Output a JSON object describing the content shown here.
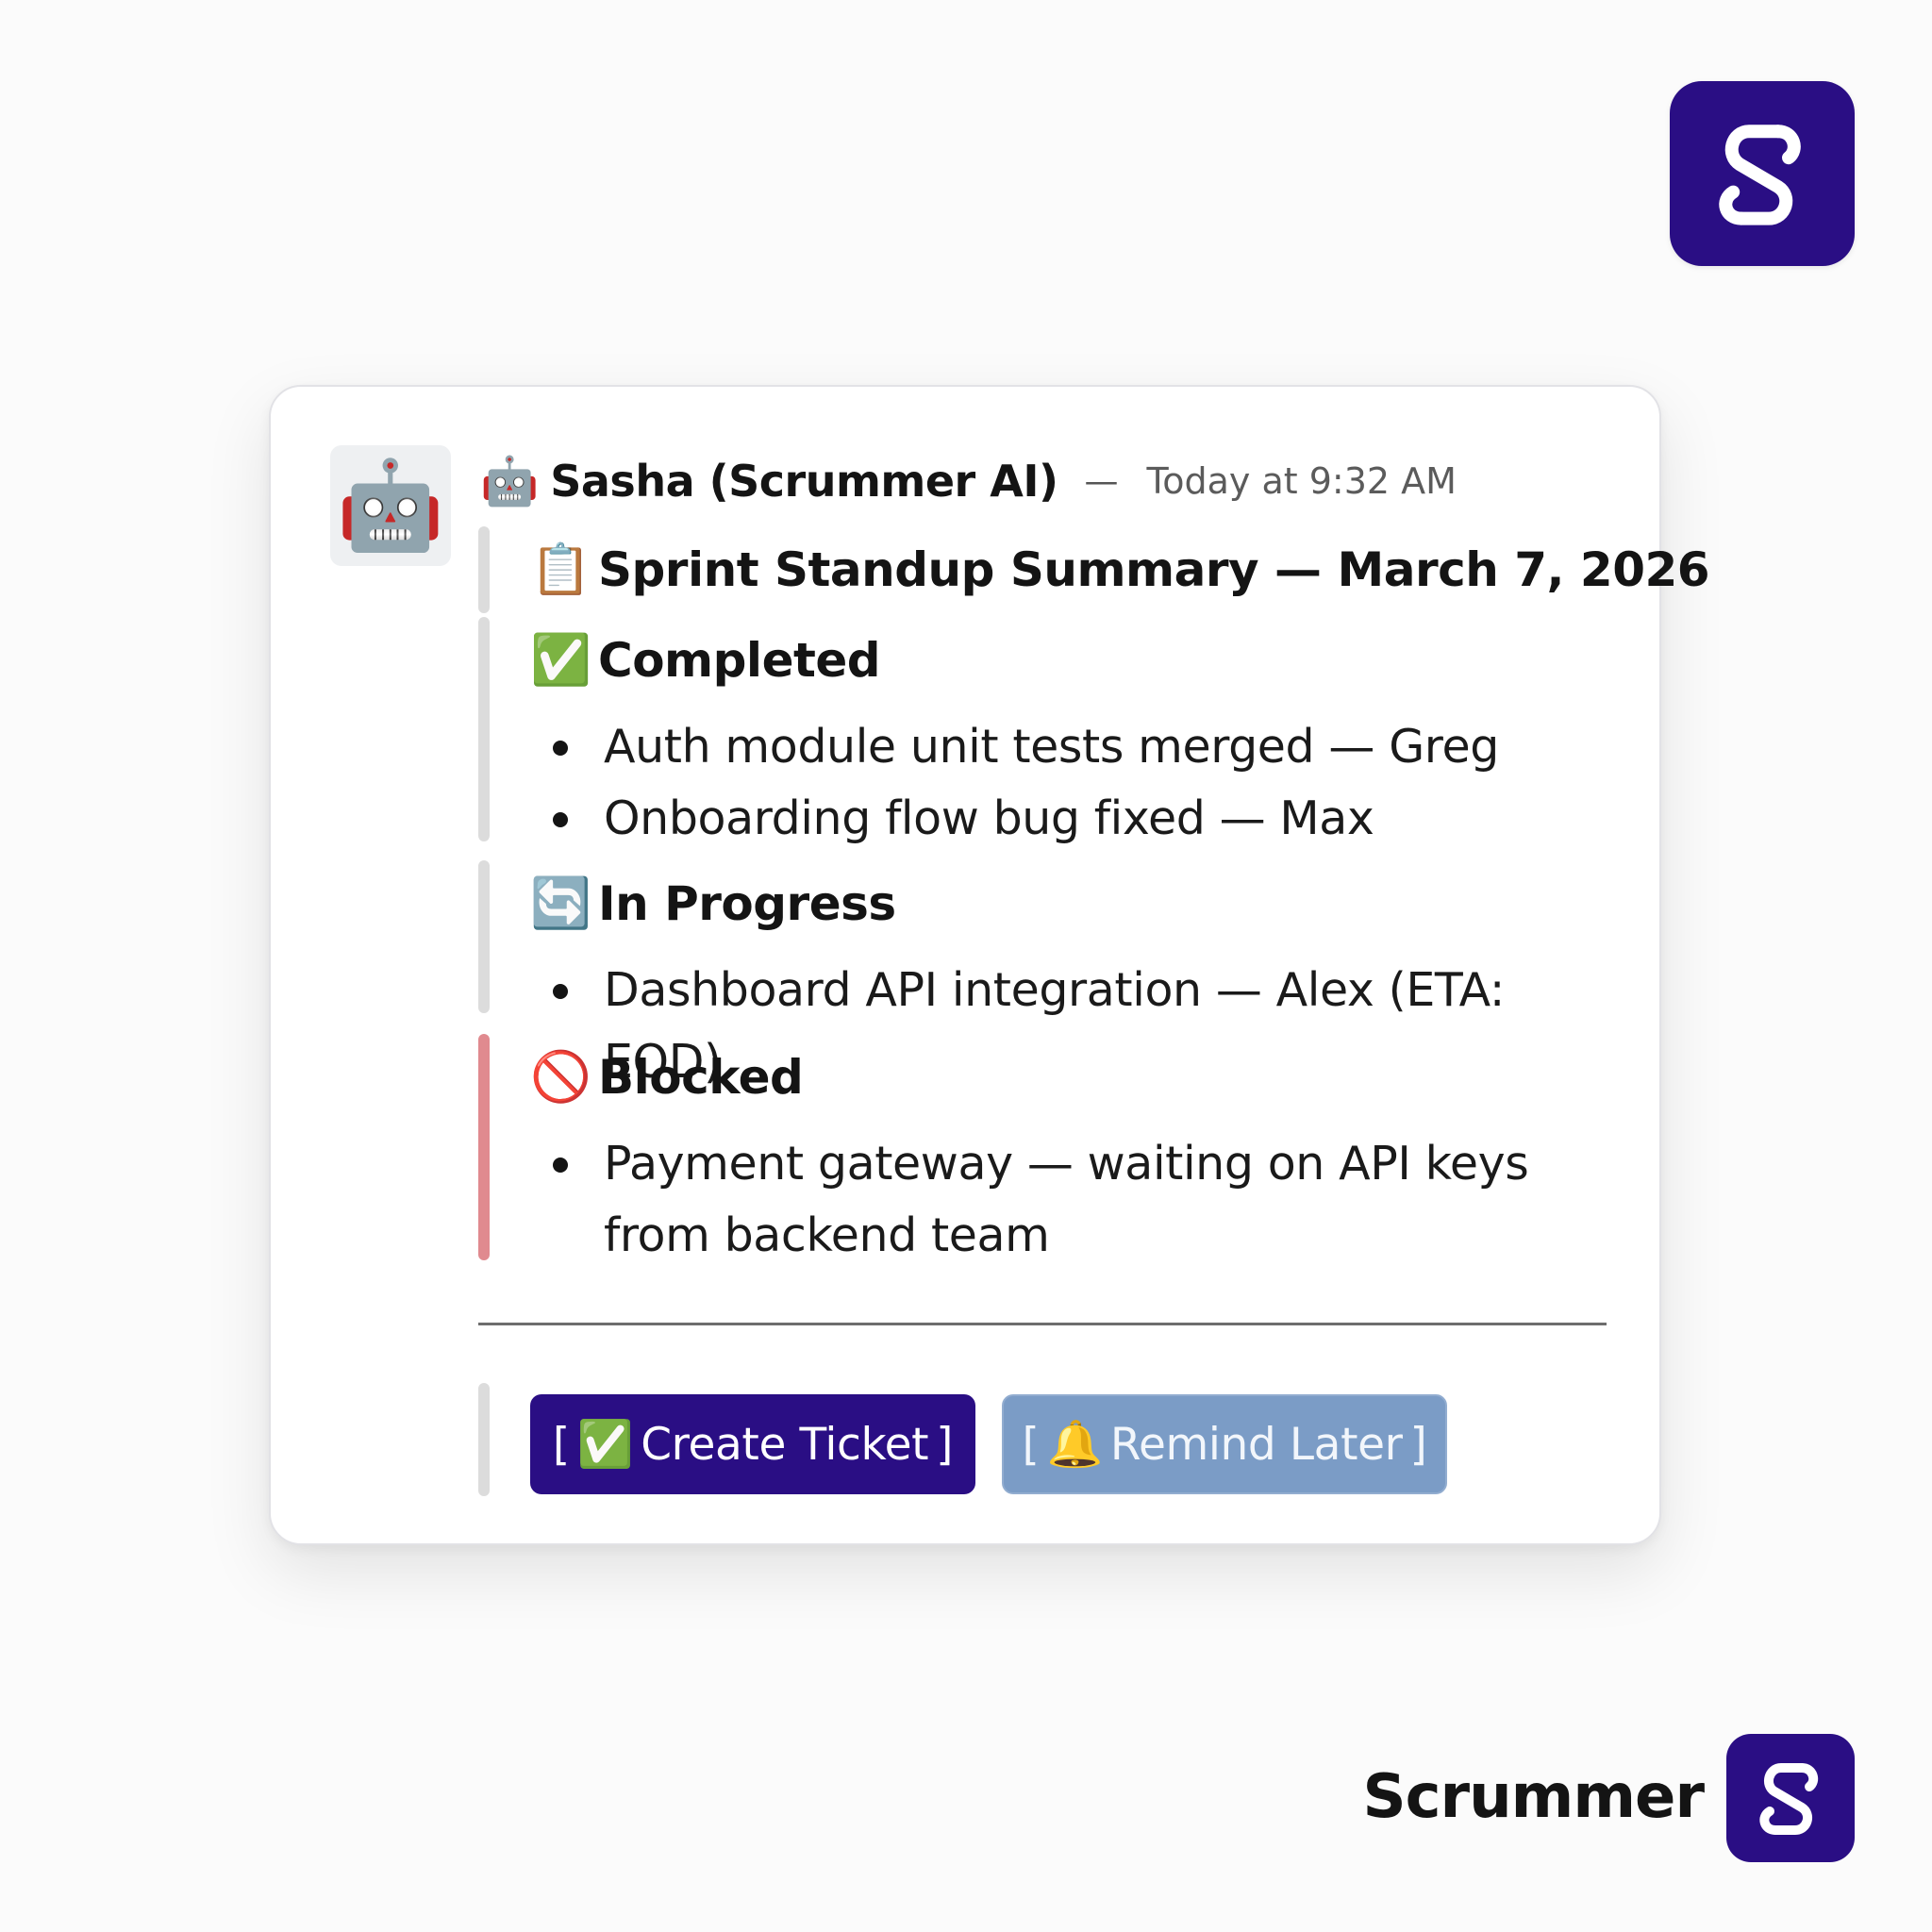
{
  "brand": {
    "name": "Scrummer",
    "accent_color": "#2a0e84",
    "logo_icon": "scrummer-s-logo-icon"
  },
  "message": {
    "avatar_icon": "🤖",
    "header_icon": "🤖",
    "sender": "Sasha (Scrummer AI)",
    "separator": "—",
    "timestamp": "Today at 9:32 AM",
    "summary": {
      "icon": "📋",
      "title": "Sprint Standup Summary — March 7, 2026"
    },
    "sections": {
      "completed": {
        "icon": "✅",
        "heading": "Completed",
        "items": [
          "Auth module unit tests merged — Greg",
          "Onboarding flow bug fixed — Max"
        ]
      },
      "in_progress": {
        "icon": "🔄",
        "heading": "In Progress",
        "items": [
          "Dashboard API integration — Alex (ETA: EOD)"
        ]
      },
      "blocked": {
        "icon": "🚫",
        "heading": "Blocked",
        "bar_color": "#e08a8f",
        "items": [
          "Payment gateway — waiting on API keys from backend team"
        ]
      }
    },
    "actions": {
      "create_ticket": {
        "open_bracket": "[",
        "icon": "✅",
        "label": "Create Ticket",
        "close_bracket": "]",
        "color": "#2a0e84"
      },
      "remind_later": {
        "open_bracket": "[",
        "icon": "🔔",
        "label": "Remind Later",
        "close_bracket": "]",
        "color": "#7b9cc6"
      }
    }
  }
}
